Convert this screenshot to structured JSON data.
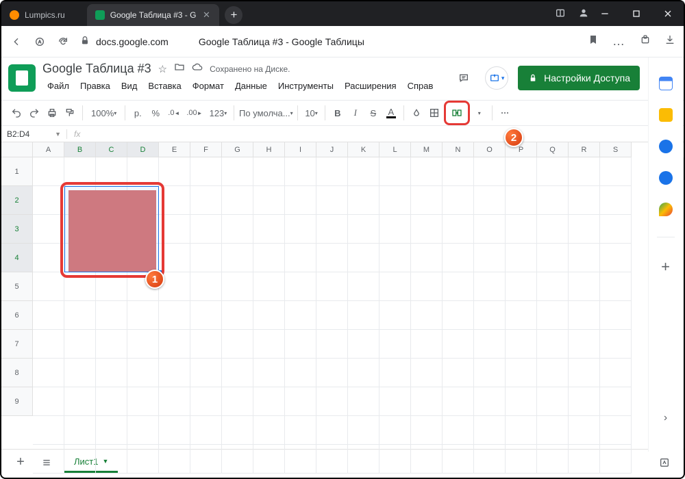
{
  "titlebar": {
    "tabs": [
      {
        "label": "Lumpics.ru",
        "favicon": "#ff8c00"
      },
      {
        "label": "Google Таблица #3 - G",
        "favicon": "#0f9d58"
      }
    ]
  },
  "urlbar": {
    "domain": "docs.google.com",
    "page_title": "Google Таблица #3 - Google Таблицы"
  },
  "doc": {
    "name": "Google Таблица #3",
    "saved": "Сохранено на Диске.",
    "menus": [
      "Файл",
      "Правка",
      "Вид",
      "Вставка",
      "Формат",
      "Данные",
      "Инструменты",
      "Расширения",
      "Справ"
    ],
    "share": "Настройки Доступа"
  },
  "toolbar": {
    "zoom": "100%",
    "currency": "р.",
    "percent": "%",
    "dec_dec": ".0",
    "dec_inc": ".00",
    "more_fmt": "123",
    "font": "По умолча...",
    "fontsize": "10"
  },
  "namebox": {
    "ref": "B2:D4",
    "fx": "fx"
  },
  "grid": {
    "cols": [
      "A",
      "B",
      "C",
      "D",
      "E",
      "F",
      "G",
      "H",
      "I",
      "J",
      "K",
      "L",
      "M",
      "N",
      "O",
      "P",
      "Q",
      "R",
      "S"
    ],
    "rows": [
      "1",
      "2",
      "3",
      "4",
      "5",
      "6",
      "7",
      "8",
      "9"
    ],
    "sel_cols": [
      "B",
      "C",
      "D"
    ],
    "sel_rows": [
      "2",
      "3",
      "4"
    ]
  },
  "sheets": {
    "active": "Лист1"
  },
  "annotations": {
    "marker1": "1",
    "marker2": "2"
  }
}
